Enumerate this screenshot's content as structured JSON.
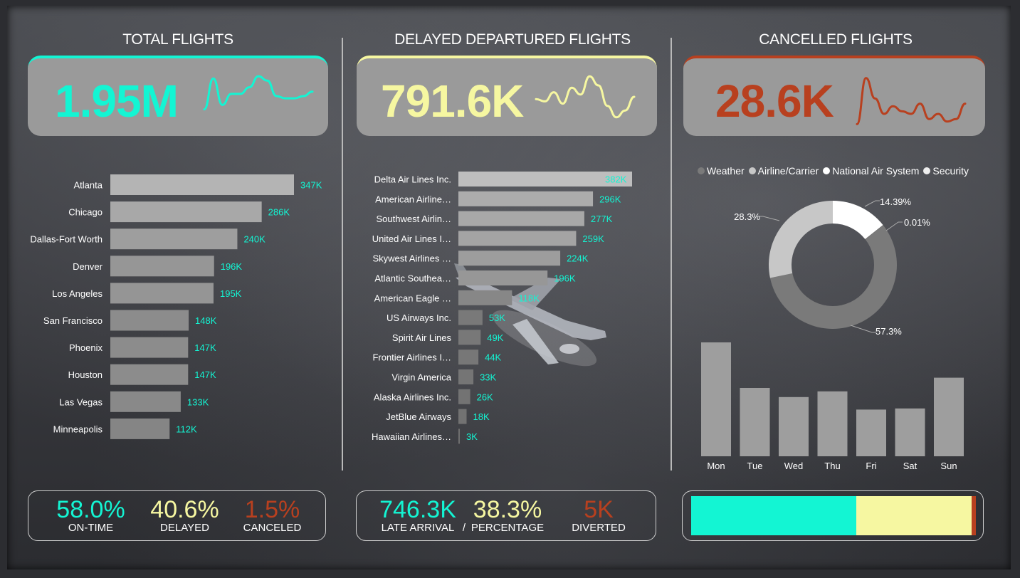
{
  "colors": {
    "teal": "#13f5d3",
    "yellow": "#f6f7a1",
    "red": "#b8401f",
    "card_bg": "#9a9a9a",
    "bar_light": "#b4b4b4",
    "bar_dark": "#717171"
  },
  "sections": {
    "total": {
      "title": "TOTAL FLIGHTS",
      "kpi": "1.95M"
    },
    "delayed": {
      "title": "DELAYED DEPARTURED FLIGHTS",
      "kpi": "791.6K"
    },
    "cancelled": {
      "title": "CANCELLED FLIGHTS",
      "kpi": "28.6K"
    }
  },
  "bottom": {
    "left": {
      "on_time": {
        "value": "58.0%",
        "label": "ON-TIME"
      },
      "delayed": {
        "value": "40.6%",
        "label": "DELAYED"
      },
      "canceled": {
        "value": "1.5%",
        "label": "CANCELED"
      }
    },
    "middle": {
      "late_arrival": {
        "value": "746.3K",
        "label": "LATE ARRIVAL"
      },
      "separator": "/",
      "percentage": {
        "value": "38.3%",
        "label": "PERCENTAGE"
      },
      "diverted": {
        "value": "5K",
        "label": "DIVERTED"
      }
    },
    "right_stack": [
      {
        "name": "on_time",
        "share": 58.0,
        "color": "#13f5d3"
      },
      {
        "name": "delayed",
        "share": 40.6,
        "color": "#f6f7a1"
      },
      {
        "name": "canceled",
        "share": 1.4,
        "color": "#b8401f"
      }
    ]
  },
  "chart_data": [
    {
      "id": "total_flights_trend",
      "type": "line",
      "values": [
        0.2,
        0.9,
        0.3,
        0.55,
        0.55,
        0.7,
        0.95,
        0.85,
        0.5,
        0.45,
        0.45,
        0.5,
        0.6
      ],
      "color": "#13f5d3"
    },
    {
      "id": "flights_by_city",
      "type": "bar",
      "orientation": "horizontal",
      "categories": [
        "Atlanta",
        "Chicago",
        "Dallas-Fort Worth",
        "Denver",
        "Los Angeles",
        "San Francisco",
        "Phoenix",
        "Houston",
        "Las Vegas",
        "Minneapolis"
      ],
      "values": [
        347,
        286,
        240,
        196,
        195,
        148,
        147,
        147,
        133,
        112
      ],
      "labels": [
        "347K",
        "286K",
        "240K",
        "196K",
        "195K",
        "148K",
        "147K",
        "147K",
        "133K",
        "112K"
      ],
      "xlim": [
        0,
        347
      ]
    },
    {
      "id": "delayed_trend",
      "type": "line",
      "values": [
        0.45,
        0.4,
        0.6,
        0.35,
        0.7,
        0.55,
        0.95,
        0.75,
        0.3,
        0.05,
        0.2,
        0.5
      ],
      "color": "#f6f7a1"
    },
    {
      "id": "delayed_by_airline",
      "type": "bar",
      "orientation": "horizontal",
      "categories": [
        "Delta Air Lines Inc.",
        "American Airline…",
        "Southwest Airlin…",
        "United Air Lines I…",
        "Skywest Airlines …",
        "Atlantic Southea…",
        "American Eagle …",
        "US Airways Inc.",
        "Spirit Air Lines",
        "Frontier Airlines I…",
        "Virgin America",
        "Alaska Airlines Inc.",
        "JetBlue Airways",
        "Hawaiian Airlines…"
      ],
      "values": [
        382,
        296,
        277,
        259,
        224,
        196,
        118,
        53,
        49,
        44,
        33,
        26,
        18,
        3
      ],
      "labels": [
        "382K",
        "296K",
        "277K",
        "259K",
        "224K",
        "196K",
        "118K",
        "53K",
        "49K",
        "44K",
        "33K",
        "26K",
        "18K",
        "3K"
      ],
      "xlim": [
        0,
        382
      ]
    },
    {
      "id": "cancelled_trend",
      "type": "line",
      "values": [
        0.05,
        0.95,
        0.55,
        0.25,
        0.4,
        0.3,
        0.25,
        0.45,
        0.15,
        0.25,
        0.1,
        0.15,
        0.45
      ],
      "color": "#b8401f"
    },
    {
      "id": "cancellation_reasons",
      "type": "pie",
      "donut": true,
      "categories": [
        "Weather",
        "Airline/Carrier",
        "National Air System",
        "Security"
      ],
      "values": [
        57.3,
        28.3,
        14.39,
        0.01
      ],
      "labels": [
        "57.3%",
        "28.3%",
        "14.39%",
        "0.01%"
      ],
      "colors": [
        "#7a7a7a",
        "#c7c7c7",
        "#ffffff",
        "#eeeeee"
      ],
      "legend": "top"
    },
    {
      "id": "cancelled_by_weekday",
      "type": "bar",
      "categories": [
        "Mon",
        "Tue",
        "Wed",
        "Thu",
        "Fri",
        "Sat",
        "Sun"
      ],
      "values": [
        100,
        60,
        52,
        57,
        41,
        42,
        69
      ],
      "color": "#9e9e9e"
    }
  ]
}
